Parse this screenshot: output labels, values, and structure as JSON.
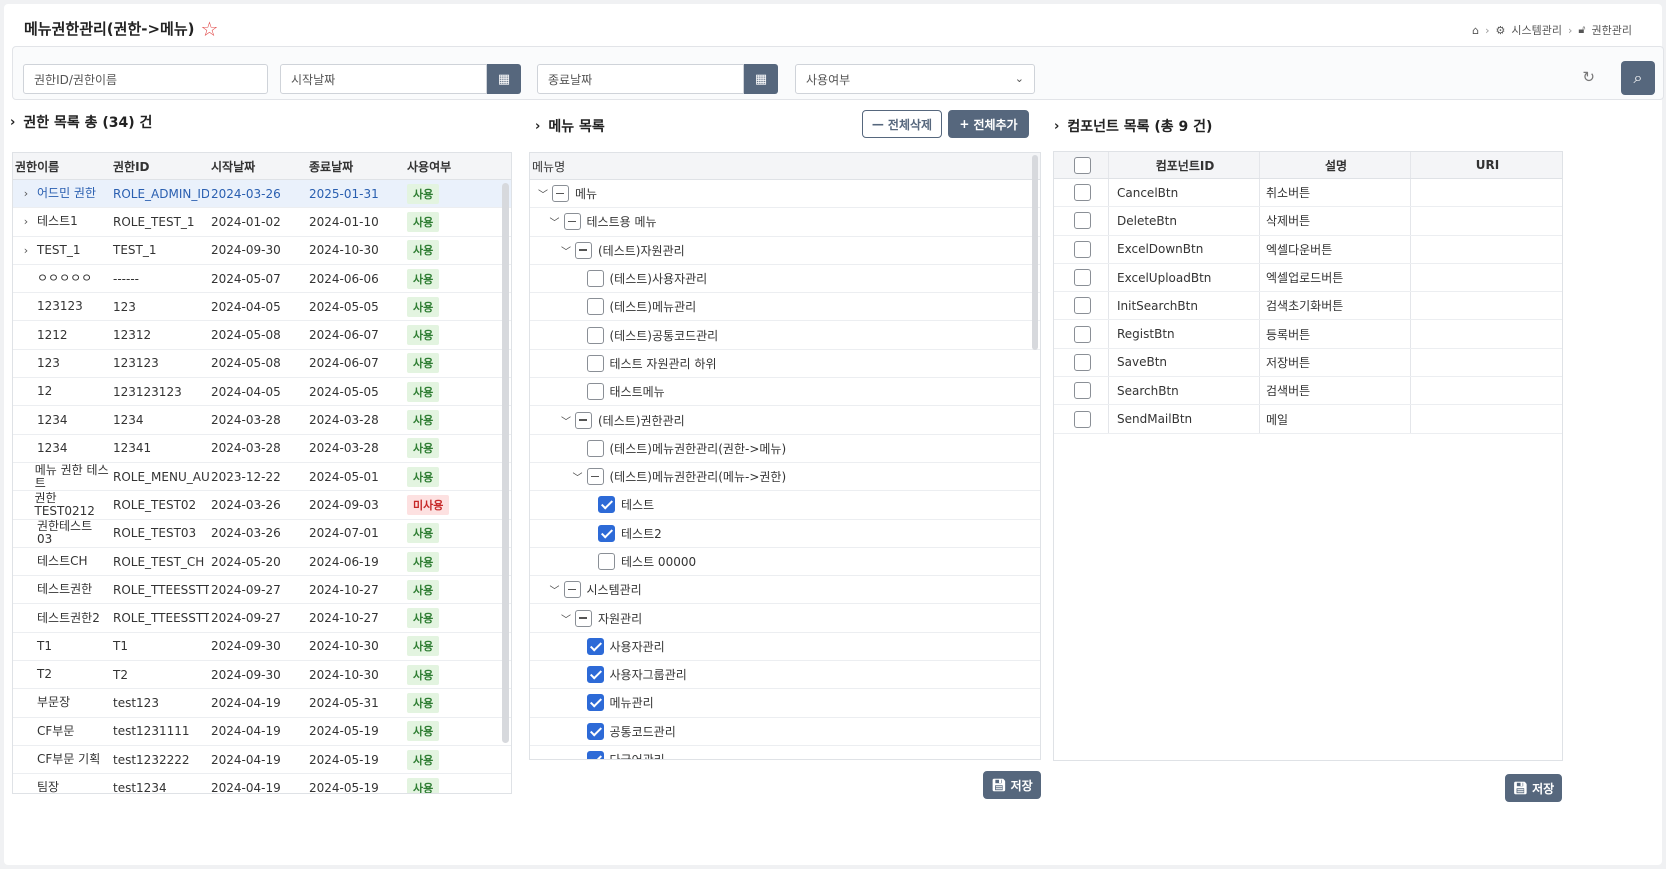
{
  "page": {
    "title": "메뉴권한관리(권한->메뉴)"
  },
  "breadcrumb": {
    "home": "⌂",
    "items": [
      "시스템관리",
      "권한관리"
    ]
  },
  "filter": {
    "authPlaceholder": "권한ID/권한이름",
    "startPlaceholder": "시작날짜",
    "endPlaceholder": "종료날짜",
    "usePlaceholder": "사용여부"
  },
  "authList": {
    "title": "권한 목록 총 (34) 건",
    "columns": [
      "권한이름",
      "권한ID",
      "시작날짜",
      "종료날짜",
      "사용여부"
    ],
    "rows": [
      {
        "expand": true,
        "name": "어드민 권한",
        "id": "ROLE_ADMIN_ID",
        "start": "2024-03-26",
        "end": "2025-01-31",
        "use": "사용"
      },
      {
        "expand": true,
        "name": "테스트1",
        "id": "ROLE_TEST_1",
        "start": "2024-01-02",
        "end": "2024-01-10",
        "use": "사용"
      },
      {
        "expand": true,
        "name": "TEST_1",
        "id": "TEST_1",
        "start": "2024-09-30",
        "end": "2024-10-30",
        "use": "사용"
      },
      {
        "expand": false,
        "name": "ㅇㅇㅇㅇㅇ",
        "id": "------",
        "start": "2024-05-07",
        "end": "2024-06-06",
        "use": "사용"
      },
      {
        "expand": false,
        "name": "123123",
        "id": "123",
        "start": "2024-04-05",
        "end": "2024-05-05",
        "use": "사용"
      },
      {
        "expand": false,
        "name": "1212",
        "id": "12312",
        "start": "2024-05-08",
        "end": "2024-06-07",
        "use": "사용"
      },
      {
        "expand": false,
        "name": "123",
        "id": "123123",
        "start": "2024-05-08",
        "end": "2024-06-07",
        "use": "사용"
      },
      {
        "expand": false,
        "name": "12",
        "id": "123123123",
        "start": "2024-04-05",
        "end": "2024-05-05",
        "use": "사용"
      },
      {
        "expand": false,
        "name": "1234",
        "id": "1234",
        "start": "2024-03-28",
        "end": "2024-03-28",
        "use": "사용"
      },
      {
        "expand": false,
        "name": "1234",
        "id": "12341",
        "start": "2024-03-28",
        "end": "2024-03-28",
        "use": "사용"
      },
      {
        "expand": false,
        "name": "메뉴 권한 테스트",
        "id": "ROLE_MENU_AUTH",
        "start": "2023-12-22",
        "end": "2024-05-01",
        "use": "사용"
      },
      {
        "expand": false,
        "name": "권한 TEST0212",
        "id": "ROLE_TEST02",
        "start": "2024-03-26",
        "end": "2024-09-03",
        "use": "미사용"
      },
      {
        "expand": false,
        "name": "권한테스트 03",
        "id": "ROLE_TEST03",
        "start": "2024-03-26",
        "end": "2024-07-01",
        "use": "사용"
      },
      {
        "expand": false,
        "name": "테스트CH",
        "id": "ROLE_TEST_CH",
        "start": "2024-05-20",
        "end": "2024-06-19",
        "use": "사용"
      },
      {
        "expand": false,
        "name": "테스트권한",
        "id": "ROLE_TTEESSTT_I",
        "start": "2024-09-27",
        "end": "2024-10-27",
        "use": "사용"
      },
      {
        "expand": false,
        "name": "테스트권한2",
        "id": "ROLE_TTEESSTT_I",
        "start": "2024-09-27",
        "end": "2024-10-27",
        "use": "사용"
      },
      {
        "expand": false,
        "name": "T1",
        "id": "T1",
        "start": "2024-09-30",
        "end": "2024-10-30",
        "use": "사용"
      },
      {
        "expand": false,
        "name": "T2",
        "id": "T2",
        "start": "2024-09-30",
        "end": "2024-10-30",
        "use": "사용"
      },
      {
        "expand": false,
        "name": "부문장",
        "id": "test123",
        "start": "2024-04-19",
        "end": "2024-05-31",
        "use": "사용"
      },
      {
        "expand": false,
        "name": "CF부문",
        "id": "test1231111",
        "start": "2024-04-19",
        "end": "2024-05-19",
        "use": "사용"
      },
      {
        "expand": false,
        "name": "CF부문 기획",
        "id": "test1232222",
        "start": "2024-04-19",
        "end": "2024-05-19",
        "use": "사용"
      },
      {
        "expand": false,
        "name": "팀장",
        "id": "test1234",
        "start": "2024-04-19",
        "end": "2024-05-19",
        "use": "사용"
      }
    ]
  },
  "menuList": {
    "title": "메뉴 목록",
    "deleteAll": "전체삭제",
    "addAll": "전체추가",
    "header": "메뉴명",
    "save": "저장",
    "rows": [
      {
        "level": 0,
        "toggle": "open",
        "state": "part",
        "label": "메뉴"
      },
      {
        "level": 1,
        "toggle": "open",
        "state": "part",
        "label": "테스트용 메뉴"
      },
      {
        "level": 2,
        "toggle": "open",
        "state": "part",
        "label": "(테스트)자원관리"
      },
      {
        "level": 3,
        "toggle": "none",
        "state": "off",
        "label": "(테스트)사용자관리"
      },
      {
        "level": 3,
        "toggle": "none",
        "state": "off",
        "label": "(테스트)메뉴관리"
      },
      {
        "level": 3,
        "toggle": "none",
        "state": "off",
        "label": "(테스트)공통코드관리"
      },
      {
        "level": 3,
        "toggle": "none",
        "state": "off",
        "label": "테스트 자원관리 하위"
      },
      {
        "level": 3,
        "toggle": "none",
        "state": "off",
        "label": "태스트메뉴"
      },
      {
        "level": 2,
        "toggle": "open",
        "state": "part",
        "label": "(테스트)권한관리"
      },
      {
        "level": 3,
        "toggle": "none",
        "state": "off",
        "label": "(테스트)메뉴권한관리(권한->메뉴)"
      },
      {
        "level": 3,
        "toggle": "open",
        "state": "part",
        "label": "(테스트)메뉴권한관리(메뉴->권한)"
      },
      {
        "level": 4,
        "toggle": "none",
        "state": "on",
        "label": "테스트"
      },
      {
        "level": 4,
        "toggle": "none",
        "state": "on",
        "label": "테스트2"
      },
      {
        "level": 4,
        "toggle": "none",
        "state": "off",
        "label": "테스트 00000"
      },
      {
        "level": 1,
        "toggle": "open",
        "state": "part",
        "label": "시스템관리"
      },
      {
        "level": 2,
        "toggle": "open",
        "state": "part",
        "label": "자원관리"
      },
      {
        "level": 3,
        "toggle": "none",
        "state": "on",
        "label": "사용자관리"
      },
      {
        "level": 3,
        "toggle": "none",
        "state": "on",
        "label": "사용자그룹관리"
      },
      {
        "level": 3,
        "toggle": "none",
        "state": "on",
        "label": "메뉴관리"
      },
      {
        "level": 3,
        "toggle": "none",
        "state": "on",
        "label": "공통코드관리"
      },
      {
        "level": 3,
        "toggle": "none",
        "state": "on",
        "label": "다국어관리"
      }
    ]
  },
  "compList": {
    "title": "컴포넌트 목록 (총 9 건)",
    "columns": [
      "컴포넌트ID",
      "설명",
      "URI"
    ],
    "save": "저장",
    "rows": [
      {
        "id": "CancelBtn",
        "desc": "취소버튼",
        "uri": ""
      },
      {
        "id": "DeleteBtn",
        "desc": "삭제버튼",
        "uri": ""
      },
      {
        "id": "ExcelDownBtn",
        "desc": "엑셀다운버튼",
        "uri": ""
      },
      {
        "id": "ExcelUploadBtn",
        "desc": "엑셀업로드버튼",
        "uri": ""
      },
      {
        "id": "InitSearchBtn",
        "desc": "검색초기화버튼",
        "uri": ""
      },
      {
        "id": "RegistBtn",
        "desc": "등록버튼",
        "uri": ""
      },
      {
        "id": "SaveBtn",
        "desc": "저장버튼",
        "uri": ""
      },
      {
        "id": "SearchBtn",
        "desc": "검색버튼",
        "uri": ""
      },
      {
        "id": "SendMailBtn",
        "desc": "메일",
        "uri": ""
      }
    ]
  }
}
